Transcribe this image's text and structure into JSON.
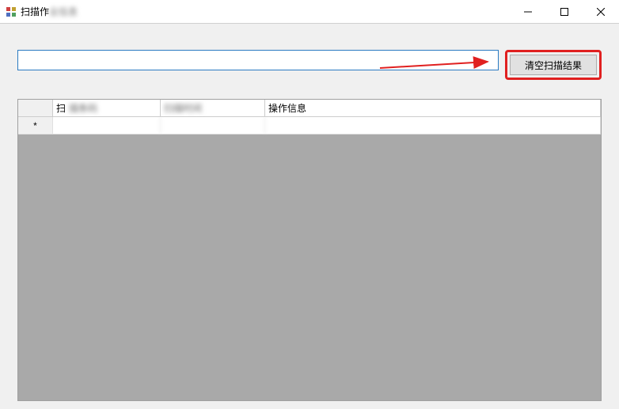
{
  "window": {
    "title_prefix": "扫描作",
    "title_blur": "业信息",
    "minimize": "–",
    "close": "✕"
  },
  "toolbar": {
    "search_placeholder": "",
    "clear_button_label": "清空扫描结果"
  },
  "grid": {
    "col1_prefix": "扫",
    "col1_blur": "描条码",
    "col2_blur": "扫描时间",
    "col3": "操作信息",
    "newrow_indicator": "*"
  },
  "annotation": {
    "arrow_color": "#e02020",
    "highlight_color": "#e02020"
  }
}
